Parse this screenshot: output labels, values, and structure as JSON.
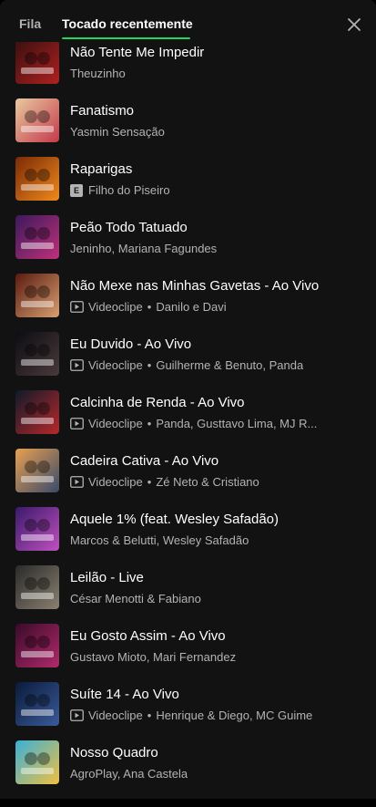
{
  "tabs": [
    {
      "label": "Fila",
      "active": false
    },
    {
      "label": "Tocado recentemente",
      "active": true
    }
  ],
  "accent_color": "#1ed760",
  "close_icon": "close-icon",
  "explicit_badge": "E",
  "tracks": [
    {
      "title": "Não Tente Me Impedir",
      "video": false,
      "explicit": false,
      "video_label": "",
      "artists": "Theuzinho",
      "colors": [
        "#3a1010",
        "#b02020"
      ]
    },
    {
      "title": "Fanatismo",
      "video": false,
      "explicit": false,
      "video_label": "",
      "artists": "Yasmin Sensação",
      "colors": [
        "#e8c9a0",
        "#c43a4a"
      ]
    },
    {
      "title": "Raparigas",
      "video": false,
      "explicit": true,
      "video_label": "",
      "artists": "Filho do Piseiro",
      "colors": [
        "#7a2a06",
        "#f08a1c"
      ]
    },
    {
      "title": "Peão Todo Tatuado",
      "video": false,
      "explicit": false,
      "video_label": "",
      "artists": "Jeninho, Mariana Fagundes",
      "colors": [
        "#3a1a5a",
        "#c0307a"
      ]
    },
    {
      "title": "Não Mexe nas Minhas Gavetas - Ao Vivo",
      "video": true,
      "explicit": false,
      "video_label": "Videoclipe",
      "artists": "Danilo e Davi",
      "colors": [
        "#5a1a10",
        "#d8a070"
      ]
    },
    {
      "title": "Eu Duvido - Ao Vivo",
      "video": true,
      "explicit": false,
      "video_label": "Videoclipe",
      "artists": "Guilherme & Benuto, Panda",
      "colors": [
        "#0c0c14",
        "#4a3a3a"
      ]
    },
    {
      "title": "Calcinha de Renda - Ao Vivo",
      "video": true,
      "explicit": false,
      "video_label": "Videoclipe",
      "artists": "Panda, Gusttavo Lima, MJ R...",
      "colors": [
        "#101a2a",
        "#b8282a"
      ]
    },
    {
      "title": "Cadeira Cativa - Ao Vivo",
      "video": true,
      "explicit": false,
      "video_label": "Videoclipe",
      "artists": "Zé Neto & Cristiano",
      "colors": [
        "#e8a050",
        "#3a4a6a"
      ]
    },
    {
      "title": "Aquele 1% (feat. Wesley Safadão)",
      "video": false,
      "explicit": false,
      "video_label": "",
      "artists": "Marcos & Belutti, Wesley Safadão",
      "colors": [
        "#3a1a6a",
        "#c050c0"
      ]
    },
    {
      "title": "Leilão - Live",
      "video": false,
      "explicit": false,
      "video_label": "",
      "artists": "César Menotti & Fabiano",
      "colors": [
        "#2a2a2a",
        "#8a8070"
      ]
    },
    {
      "title": "Eu Gosto Assim - Ao Vivo",
      "video": false,
      "explicit": false,
      "video_label": "",
      "artists": "Gustavo Mioto, Mari Fernandez",
      "colors": [
        "#3a0a2a",
        "#b02a6a"
      ]
    },
    {
      "title": "Suíte 14 - Ao Vivo",
      "video": true,
      "explicit": false,
      "video_label": "Videoclipe",
      "artists": "Henrique & Diego, MC Guime",
      "colors": [
        "#0a1a3a",
        "#3a5a9a"
      ]
    },
    {
      "title": "Nosso Quadro",
      "video": false,
      "explicit": false,
      "video_label": "",
      "artists": "AgroPlay, Ana Castela",
      "colors": [
        "#3ab0d8",
        "#f0c040"
      ]
    }
  ]
}
